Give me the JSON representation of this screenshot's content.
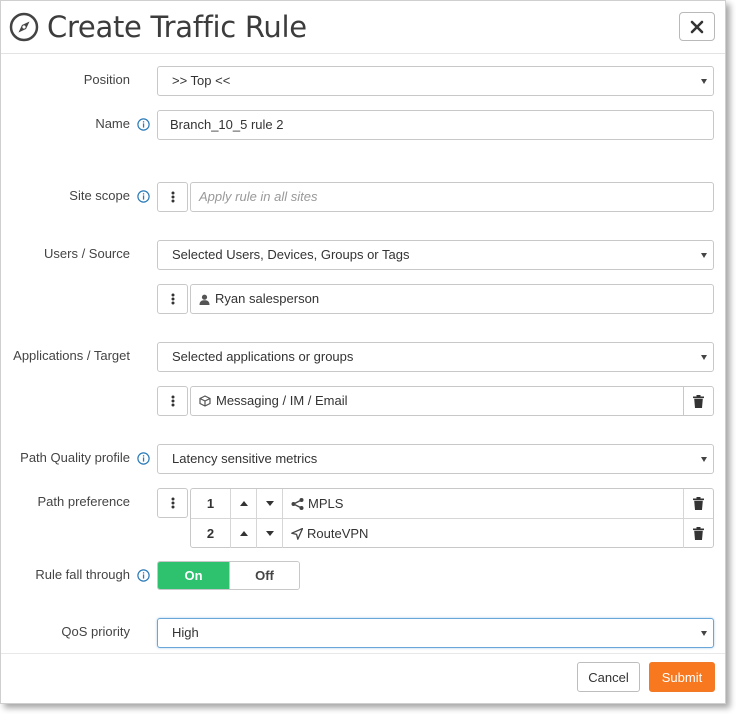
{
  "dialog": {
    "title": "Create Traffic Rule",
    "title_icon": "compass-icon",
    "close_icon": "close-icon"
  },
  "position": {
    "label": "Position",
    "value": ">> Top <<"
  },
  "name": {
    "label": "Name",
    "value": "Branch_10_5 rule 2"
  },
  "site_scope": {
    "label": "Site scope",
    "placeholder": "Apply rule in all sites"
  },
  "users": {
    "label": "Users / Source",
    "value": "Selected Users, Devices, Groups or Tags",
    "items": [
      {
        "label": "Ryan salesperson",
        "icon": "user-icon"
      }
    ]
  },
  "applications": {
    "label": "Applications / Target",
    "value": "Selected applications or groups",
    "items": [
      {
        "label": "Messaging / IM / Email",
        "icon": "cube-icon"
      }
    ]
  },
  "path_quality": {
    "label": "Path Quality profile",
    "value": "Latency sensitive metrics"
  },
  "path_preference": {
    "label": "Path preference",
    "rows": [
      {
        "order": "1",
        "name": "MPLS",
        "icon": "share-icon"
      },
      {
        "order": "2",
        "name": "RouteVPN",
        "icon": "location-arrow-icon"
      }
    ]
  },
  "fall_through": {
    "label": "Rule fall through",
    "on_label": "On",
    "off_label": "Off",
    "selected": "On"
  },
  "qos": {
    "label": "QoS priority",
    "value": "High"
  },
  "footer": {
    "cancel_label": "Cancel",
    "submit_label": "Submit"
  },
  "colors": {
    "accent_submit": "#f7781f",
    "toggle_on": "#2ec26f",
    "info_icon": "#2a7ab8",
    "focus_border": "#6aa7d8"
  }
}
